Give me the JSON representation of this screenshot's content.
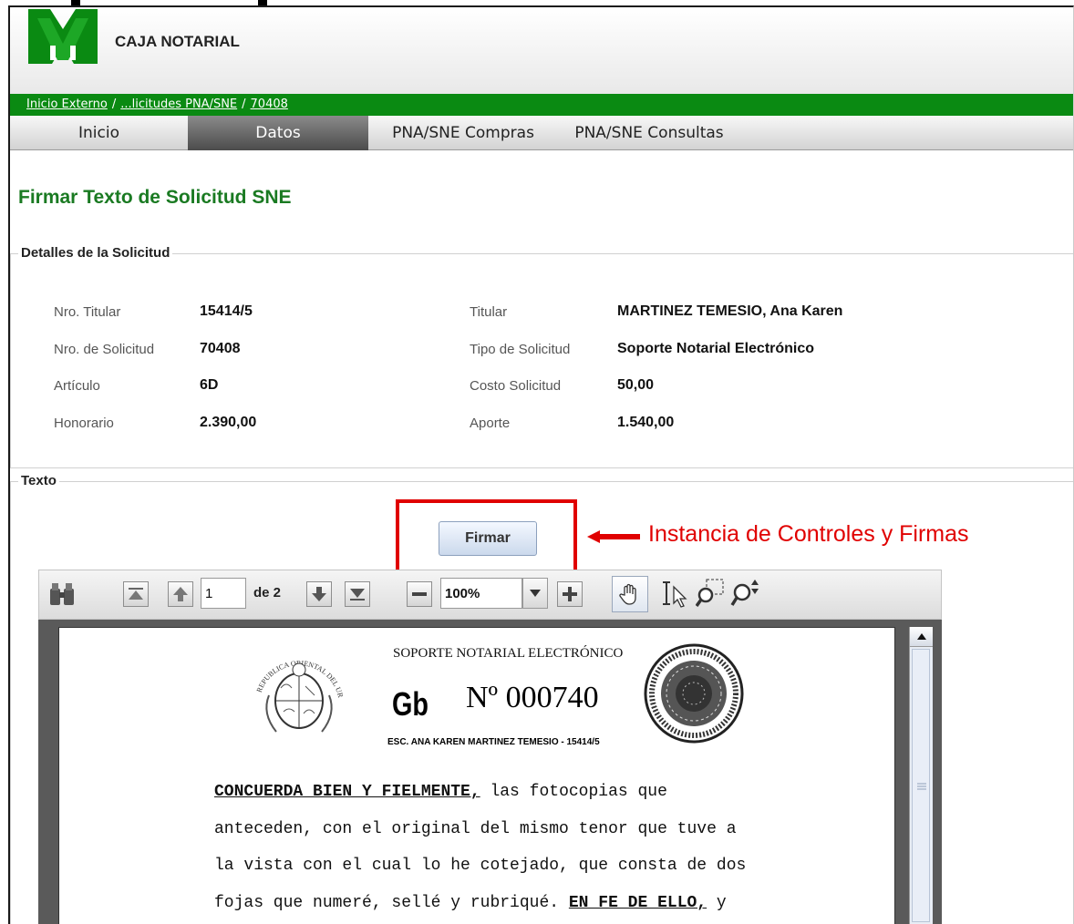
{
  "app": {
    "brand": "CAJA NOTARIAL"
  },
  "breadcrumb": {
    "item1": "Inicio Externo",
    "item2": "...licitudes PNA/SNE",
    "item3": "70408",
    "separator": "/"
  },
  "menu": {
    "tabs": [
      {
        "label": "Inicio"
      },
      {
        "label": "Datos"
      },
      {
        "label": "PNA/SNE Compras"
      },
      {
        "label": "PNA/SNE Consultas"
      }
    ]
  },
  "page": {
    "title": "Firmar Texto de Solicitud SNE"
  },
  "details": {
    "legend": "Detalles de la Solicitud",
    "nro_titular_label": "Nro. Titular",
    "nro_titular": "15414/5",
    "nro_solicitud_label": "Nro. de Solicitud",
    "nro_solicitud": "70408",
    "articulo_label": "Artículo",
    "articulo": "6D",
    "honorario_label": "Honorario",
    "honorario": "2.390,00",
    "titular_label": "Titular",
    "titular": "MARTINEZ TEMESIO, Ana Karen",
    "tipo_label": "Tipo de Solicitud",
    "tipo": "Soporte Notarial Electrónico",
    "costo_label": "Costo Solicitud",
    "costo": "50,00",
    "aporte_label": "Aporte",
    "aporte": "1.540,00"
  },
  "texto": {
    "legend": "Texto",
    "sign_button": "Firmar"
  },
  "annotation": {
    "text": "Instancia de Controles y Firmas",
    "color": "#e00000"
  },
  "pdf_toolbar": {
    "page_value": "1",
    "page_of": "de 2",
    "zoom_value": "100%",
    "icons": [
      "binoculars-icon",
      "first-page-icon",
      "prev-page-icon",
      "next-page-icon",
      "last-page-icon",
      "zoom-out-icon",
      "zoom-dropdown-icon",
      "zoom-in-icon",
      "hand-tool-icon",
      "text-select-icon",
      "marquee-zoom-icon",
      "dynamic-zoom-icon"
    ]
  },
  "document": {
    "header": "SOPORTE NOTARIAL ELECTRÓNICO",
    "series": "Gb",
    "number": "Nº 000740",
    "escribano": "ESC. ANA KAREN MARTINEZ TEMESIO - 15414/5",
    "seal_text": "REPUBLICA ORIENTAL DEL URUGUAY",
    "line1_bold": "CONCUERDA BIEN Y FIELMENTE,",
    "line1_rest": " las fotocopias que",
    "line2": "anteceden, con el original del mismo tenor que tuve a",
    "line3": "la vista con el cual lo he cotejado, que consta de dos",
    "line4_start": "fojas que numeré, sellé y rubriqué. ",
    "line4_bold": "EN FE DE ELLO,",
    "line4_end": " y"
  },
  "colors": {
    "brand_green": "#0a8a12",
    "title_green": "#1a7a22",
    "annotation_red": "#e00000"
  }
}
